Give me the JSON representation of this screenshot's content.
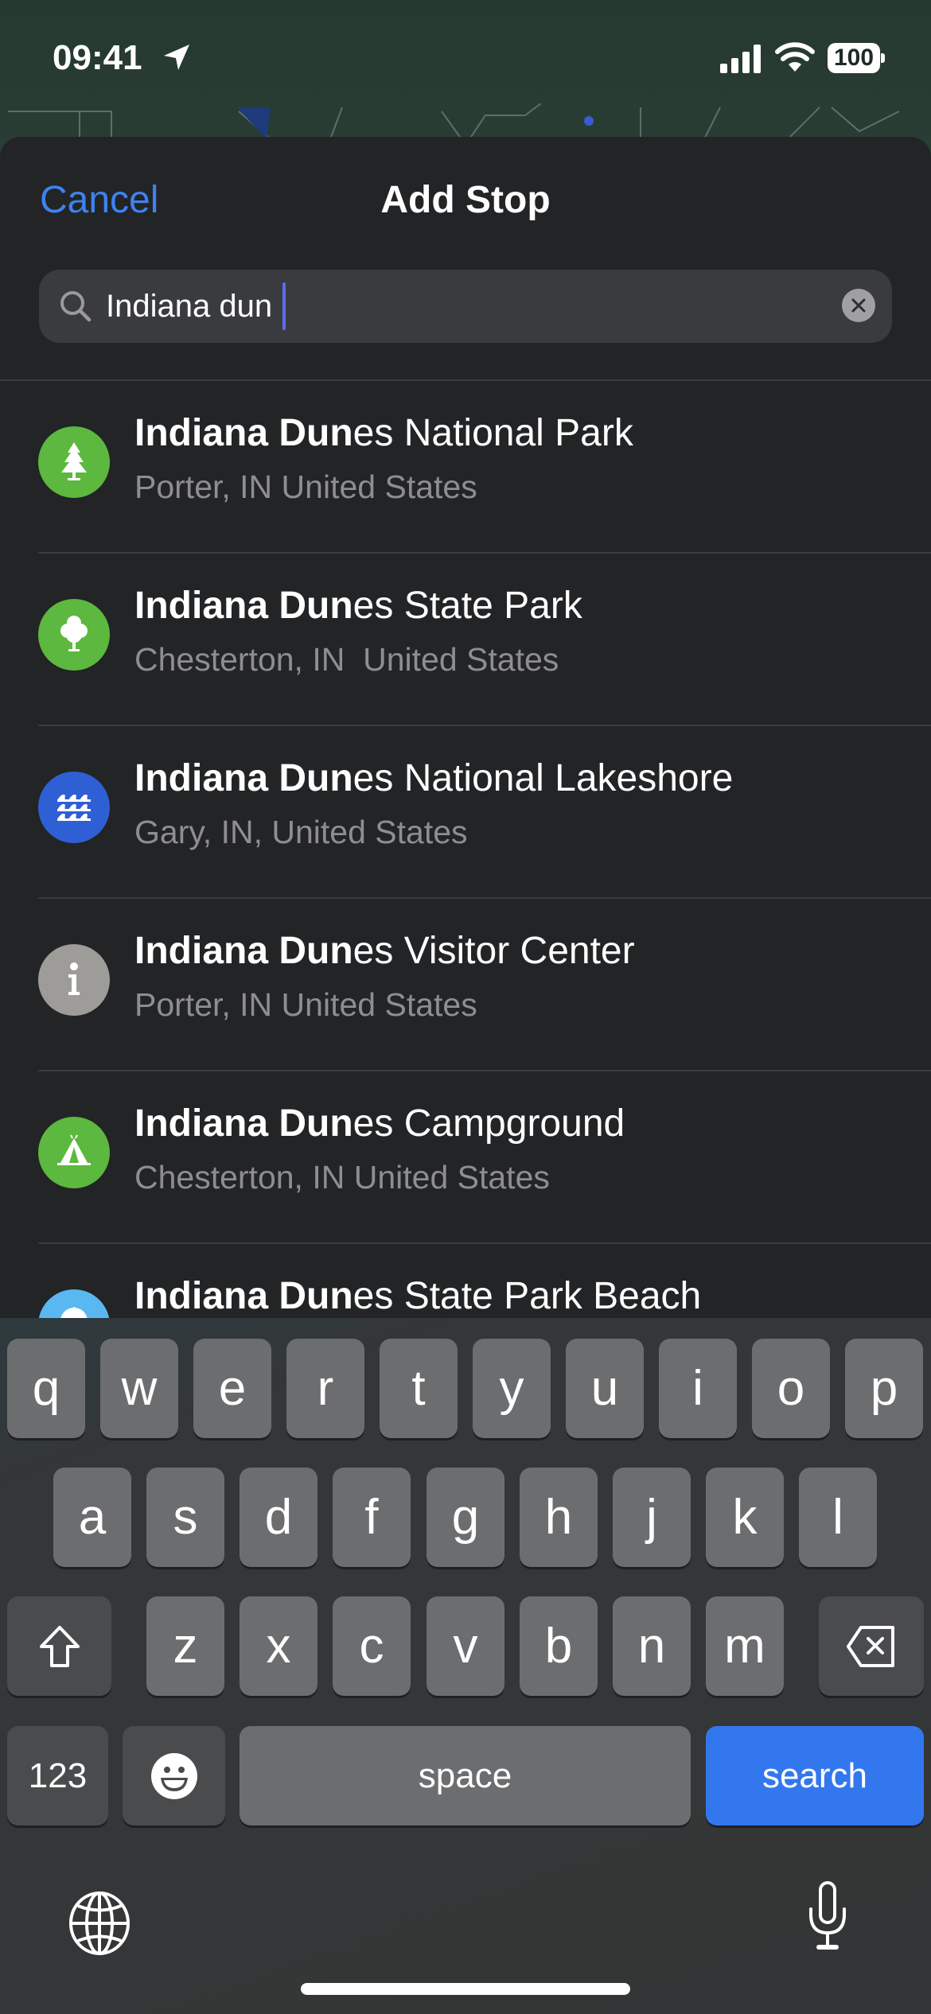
{
  "status_bar": {
    "time": "09:41",
    "battery": "100"
  },
  "sheet": {
    "cancel_label": "Cancel",
    "title": "Add Stop"
  },
  "search": {
    "value": "Indiana dun",
    "placeholder": ""
  },
  "results": [
    {
      "match": "Indiana Dun",
      "rest": "es National Park",
      "subtitle": "Porter, IN United States",
      "icon": "tree-icon",
      "color": "#5cb83e"
    },
    {
      "match": "Indiana Dun",
      "rest": "es State Park",
      "subtitle": "Chesterton, IN  United States",
      "icon": "deciduous-tree-icon",
      "color": "#5cb83e"
    },
    {
      "match": "Indiana Dun",
      "rest": "es National Lakeshore",
      "subtitle": "Gary, IN, United States",
      "icon": "water-waves-icon",
      "color": "#2f5fd4"
    },
    {
      "match": "Indiana Dun",
      "rest": "es Visitor Center",
      "subtitle": "Porter, IN United States",
      "icon": "info-icon",
      "color": "#9d9c99"
    },
    {
      "match": "Indiana Dun",
      "rest": "es Campground",
      "subtitle": "Chesterton, IN United States",
      "icon": "tent-icon",
      "color": "#5cb83e"
    },
    {
      "match": "Indiana Dun",
      "rest": "es State Park Beach",
      "subtitle": "",
      "icon": "beach-umbrella-icon",
      "color": "#5ab8f0"
    }
  ],
  "keyboard": {
    "row1": [
      "q",
      "w",
      "e",
      "r",
      "t",
      "y",
      "u",
      "i",
      "o",
      "p"
    ],
    "row2": [
      "a",
      "s",
      "d",
      "f",
      "g",
      "h",
      "j",
      "k",
      "l"
    ],
    "row3": [
      "z",
      "x",
      "c",
      "v",
      "b",
      "n",
      "m"
    ],
    "numbers_label": "123",
    "space_label": "space",
    "return_label": "search"
  },
  "colors": {
    "accent": "#3e82f0",
    "search_key": "#3377ee",
    "sheet_bg": "#222426"
  }
}
